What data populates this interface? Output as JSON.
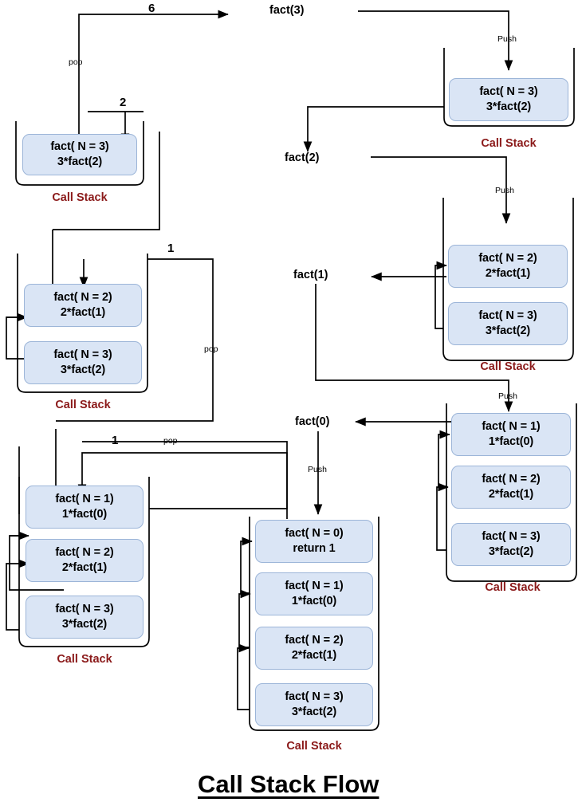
{
  "title": "Call Stack Flow",
  "stack_label": "Call Stack",
  "frames": {
    "f3": {
      "line1": "fact( N = 3)",
      "line2": "3*fact(2)"
    },
    "f2": {
      "line1": "fact( N = 2)",
      "line2": "2*fact(1)"
    },
    "f1": {
      "line1": "fact( N = 1)",
      "line2": "1*fact(0)"
    },
    "f0": {
      "line1": "fact( N = 0)",
      "line2": "return 1"
    }
  },
  "call_nodes": {
    "fact3": "fact(3)",
    "fact2": "fact(2)",
    "fact1": "fact(1)",
    "fact0": "fact(0)"
  },
  "edge_labels": {
    "push": "Push",
    "pop": "pop",
    "ret6": "6",
    "ret2": "2",
    "ret1a": "1",
    "ret1b": "1"
  },
  "colors": {
    "frame_fill": "#dae5f5",
    "frame_border": "#9cb5d8",
    "stack_label": "#8b1a1a",
    "line": "#000000",
    "text": "#000000"
  },
  "chart_data": {
    "type": "diagram",
    "title": "Call Stack Flow",
    "description": "Recursive factorial fact(3) call-stack push/pop walkthrough",
    "stacks": [
      {
        "id": "stack-push-1",
        "position": "top-right",
        "frames": [
          "fact( N = 3) 3*fact(2)"
        ]
      },
      {
        "id": "stack-push-2",
        "position": "middle-right",
        "frames": [
          "fact( N = 2) 2*fact(1)",
          "fact( N = 3) 3*fact(2)"
        ]
      },
      {
        "id": "stack-push-3",
        "position": "bottom-right",
        "frames": [
          "fact( N = 1) 1*fact(0)",
          "fact( N = 2) 2*fact(1)",
          "fact( N = 3) 3*fact(2)"
        ]
      },
      {
        "id": "stack-full",
        "position": "bottom-center",
        "frames": [
          "fact( N = 0) return 1",
          "fact( N = 1) 1*fact(0)",
          "fact( N = 2) 2*fact(1)",
          "fact( N = 3) 3*fact(2)"
        ]
      },
      {
        "id": "stack-pop-1",
        "position": "bottom-left",
        "frames": [
          "fact( N = 1) 1*fact(0)",
          "fact( N = 2) 2*fact(1)",
          "fact( N = 3) 3*fact(2)"
        ]
      },
      {
        "id": "stack-pop-2",
        "position": "middle-left",
        "frames": [
          "fact( N = 2) 2*fact(1)",
          "fact( N = 3) 3*fact(2)"
        ]
      },
      {
        "id": "stack-pop-3",
        "position": "top-left",
        "frames": [
          "fact( N = 3) 3*fact(2)"
        ]
      }
    ],
    "return_values": [
      "1",
      "1",
      "2",
      "6"
    ]
  }
}
